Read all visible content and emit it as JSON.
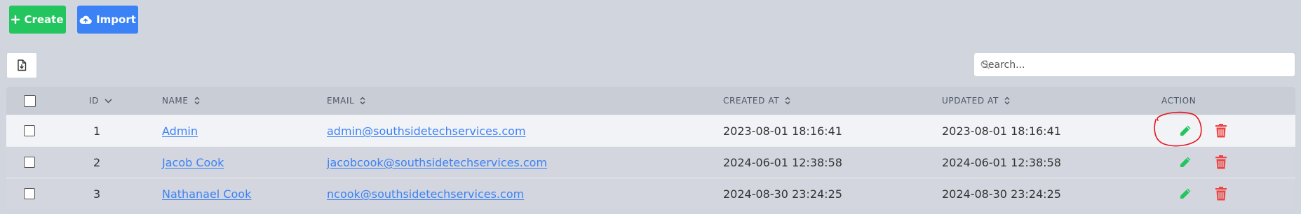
{
  "toolbar": {
    "create_label": "Create",
    "import_label": "Import"
  },
  "search": {
    "placeholder": "Search...",
    "value": ""
  },
  "table": {
    "columns": {
      "id": "ID",
      "name": "NAME",
      "email": "EMAIL",
      "created_at": "CREATED AT",
      "updated_at": "UPDATED AT",
      "action": "ACTION"
    },
    "rows": [
      {
        "id": "1",
        "name": "Admin",
        "email": "admin@southsidetechservices.com",
        "created_at": "2023-08-01 18:16:41",
        "updated_at": "2023-08-01 18:16:41"
      },
      {
        "id": "2",
        "name": "Jacob Cook",
        "email": "jacobcook@southsidetechservices.com",
        "created_at": "2024-06-01 12:38:58",
        "updated_at": "2024-06-01 12:38:58"
      },
      {
        "id": "3",
        "name": "Nathanael Cook",
        "email": "ncook@southsidetechservices.com",
        "created_at": "2024-08-30 23:24:25",
        "updated_at": "2024-08-30 23:24:25"
      }
    ]
  },
  "icons": {
    "create": "plus-icon",
    "import": "cloud-upload-icon",
    "export": "file-download-icon",
    "search": "search-icon",
    "sort": "sort-icon",
    "edit": "pencil-icon",
    "delete": "trash-icon"
  },
  "colors": {
    "create_button": "#22c55e",
    "import_button": "#3b82f6",
    "edit_icon": "#22c55e",
    "delete_icon": "#ef4444",
    "link": "#3b82f6",
    "annotation": "#e5141d"
  }
}
